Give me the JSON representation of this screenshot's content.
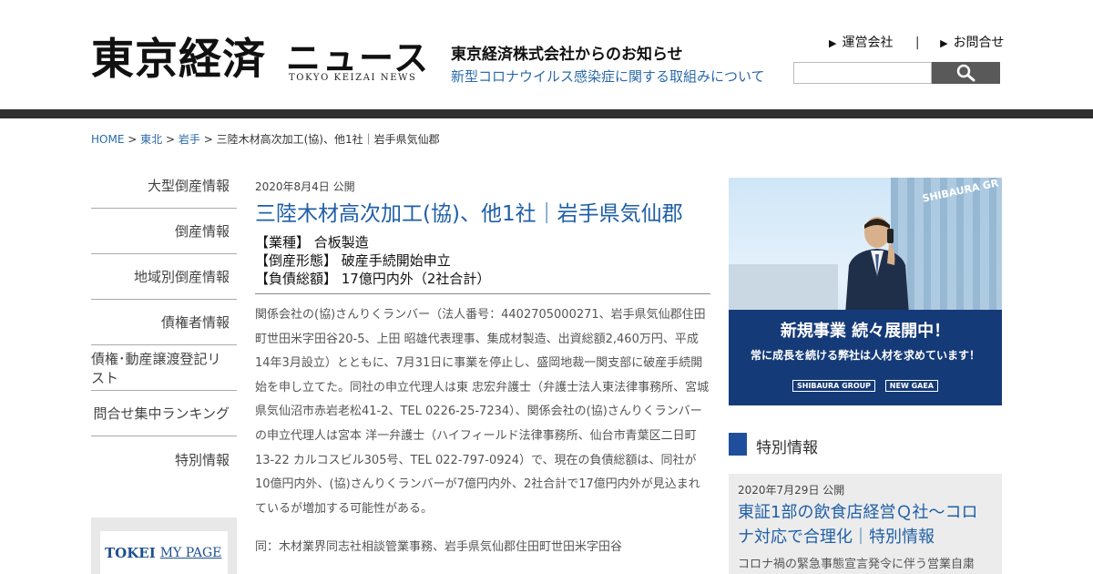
{
  "header": {
    "logo_main": "東京経済",
    "logo_kana": "ニュース",
    "logo_sub": "TOKYO KEIZAI NEWS",
    "notice_title": "東京経済株式会社からのお知らせ",
    "notice_link": "新型コロナウイルス感染症に関する取組みについて",
    "link_company": "運営会社",
    "link_separator": "|",
    "link_contact": "お問合せ",
    "search_placeholder": ""
  },
  "breadcrumb": {
    "home": "HOME",
    "region": "東北",
    "prefecture": "岩手",
    "sep": ">",
    "current": "三陸木材高次加工(協)、他1社｜岩手県気仙郡"
  },
  "sidebar": {
    "items": [
      {
        "label": "大型倒産情報"
      },
      {
        "label": "倒産情報"
      },
      {
        "label": "地域別倒産情報"
      },
      {
        "label": "債権者情報"
      },
      {
        "label": "債権･動産譲渡登記リスト"
      },
      {
        "label": "問合せ集中ランキング"
      },
      {
        "label": "特別情報"
      }
    ],
    "mypage_a": "TOKEI",
    "mypage_b": "MY PAGE"
  },
  "article": {
    "date": "2020年8月4日 公開",
    "title": "三陸木材高次加工(協)、他1社｜岩手県気仙郡",
    "industry": "【業種】 合板製造",
    "bankruptcy_type": "【倒産形態】 破産手続開始申立",
    "debt": "【負債総額】 17億円内外（2社合計）",
    "body": "関係会社の(協)さんりくランバー（法人番号：4402705000271、岩手県気仙郡住田町世田米字田谷20-5、上田 昭雄代表理事、集成材製造、出資総額2,460万円、平成14年3月設立）とともに、7月31日に事業を停止し、盛岡地裁一関支部に破産手続開始を申し立てた。同社の申立代理人は東 忠宏弁護士（弁護士法人東法律事務所、宮城県気仙沼市赤岩老松41-2、TEL 0226-25-7234）、関係会社の(協)さんりくランバーの申立代理人は宮本 洋一弁護士（ハイフィールド法律事務所、仙台市青葉区二日町13-22 カルコスビル305号、TEL 022-797-0924）で、現在の負債総額は、同社が10億円内外、(協)さんりくランバーが7億円内外、2社合計で17億円内外が見込まれているが増加する可能性がある。",
    "body2": "同：木材業界同志社相談管業事務、岩手県気仙郡住田町世田米字田谷"
  },
  "ad": {
    "sign": "SHIBAURA GR",
    "headline": "新規事業 続々展開中！",
    "subline": "常に成長を続ける弊社は人材を求めています！",
    "logo1": "SHIBAURA GROUP",
    "logo2": "NEW GAEA"
  },
  "special_section": {
    "heading": "特別情報",
    "date": "2020年7月29日 公開",
    "title": "東証1部の飲食店経営Ｑ社～コロナ対応で合理化｜特別情報",
    "desc": "コロナ禍の緊急事態宣言発令に伴う営業自粛"
  },
  "colors": {
    "link_blue": "#2a6aa8",
    "title_blue": "#1f5fa6",
    "dark_bar": "#2f2f2f",
    "ad_navy": "#153a78"
  }
}
